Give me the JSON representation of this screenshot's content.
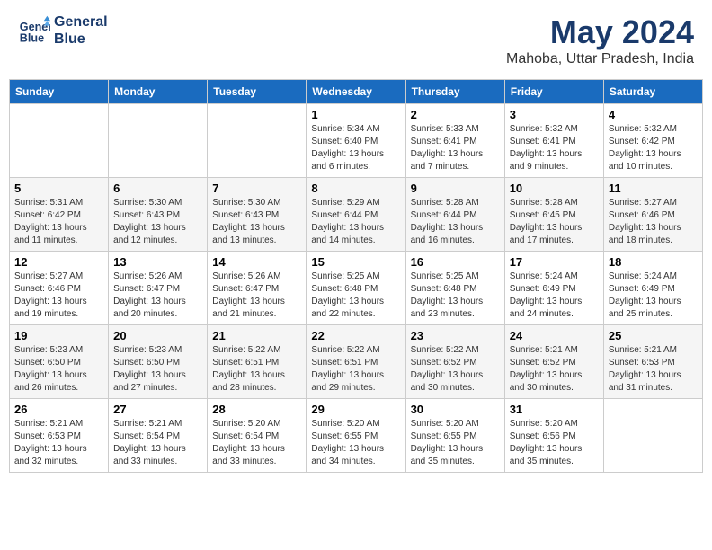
{
  "header": {
    "logo_line1": "General",
    "logo_line2": "Blue",
    "month": "May 2024",
    "location": "Mahoba, Uttar Pradesh, India"
  },
  "weekdays": [
    "Sunday",
    "Monday",
    "Tuesday",
    "Wednesday",
    "Thursday",
    "Friday",
    "Saturday"
  ],
  "weeks": [
    [
      {
        "day": "",
        "info": ""
      },
      {
        "day": "",
        "info": ""
      },
      {
        "day": "",
        "info": ""
      },
      {
        "day": "1",
        "info": "Sunrise: 5:34 AM\nSunset: 6:40 PM\nDaylight: 13 hours\nand 6 minutes."
      },
      {
        "day": "2",
        "info": "Sunrise: 5:33 AM\nSunset: 6:41 PM\nDaylight: 13 hours\nand 7 minutes."
      },
      {
        "day": "3",
        "info": "Sunrise: 5:32 AM\nSunset: 6:41 PM\nDaylight: 13 hours\nand 9 minutes."
      },
      {
        "day": "4",
        "info": "Sunrise: 5:32 AM\nSunset: 6:42 PM\nDaylight: 13 hours\nand 10 minutes."
      }
    ],
    [
      {
        "day": "5",
        "info": "Sunrise: 5:31 AM\nSunset: 6:42 PM\nDaylight: 13 hours\nand 11 minutes."
      },
      {
        "day": "6",
        "info": "Sunrise: 5:30 AM\nSunset: 6:43 PM\nDaylight: 13 hours\nand 12 minutes."
      },
      {
        "day": "7",
        "info": "Sunrise: 5:30 AM\nSunset: 6:43 PM\nDaylight: 13 hours\nand 13 minutes."
      },
      {
        "day": "8",
        "info": "Sunrise: 5:29 AM\nSunset: 6:44 PM\nDaylight: 13 hours\nand 14 minutes."
      },
      {
        "day": "9",
        "info": "Sunrise: 5:28 AM\nSunset: 6:44 PM\nDaylight: 13 hours\nand 16 minutes."
      },
      {
        "day": "10",
        "info": "Sunrise: 5:28 AM\nSunset: 6:45 PM\nDaylight: 13 hours\nand 17 minutes."
      },
      {
        "day": "11",
        "info": "Sunrise: 5:27 AM\nSunset: 6:46 PM\nDaylight: 13 hours\nand 18 minutes."
      }
    ],
    [
      {
        "day": "12",
        "info": "Sunrise: 5:27 AM\nSunset: 6:46 PM\nDaylight: 13 hours\nand 19 minutes."
      },
      {
        "day": "13",
        "info": "Sunrise: 5:26 AM\nSunset: 6:47 PM\nDaylight: 13 hours\nand 20 minutes."
      },
      {
        "day": "14",
        "info": "Sunrise: 5:26 AM\nSunset: 6:47 PM\nDaylight: 13 hours\nand 21 minutes."
      },
      {
        "day": "15",
        "info": "Sunrise: 5:25 AM\nSunset: 6:48 PM\nDaylight: 13 hours\nand 22 minutes."
      },
      {
        "day": "16",
        "info": "Sunrise: 5:25 AM\nSunset: 6:48 PM\nDaylight: 13 hours\nand 23 minutes."
      },
      {
        "day": "17",
        "info": "Sunrise: 5:24 AM\nSunset: 6:49 PM\nDaylight: 13 hours\nand 24 minutes."
      },
      {
        "day": "18",
        "info": "Sunrise: 5:24 AM\nSunset: 6:49 PM\nDaylight: 13 hours\nand 25 minutes."
      }
    ],
    [
      {
        "day": "19",
        "info": "Sunrise: 5:23 AM\nSunset: 6:50 PM\nDaylight: 13 hours\nand 26 minutes."
      },
      {
        "day": "20",
        "info": "Sunrise: 5:23 AM\nSunset: 6:50 PM\nDaylight: 13 hours\nand 27 minutes."
      },
      {
        "day": "21",
        "info": "Sunrise: 5:22 AM\nSunset: 6:51 PM\nDaylight: 13 hours\nand 28 minutes."
      },
      {
        "day": "22",
        "info": "Sunrise: 5:22 AM\nSunset: 6:51 PM\nDaylight: 13 hours\nand 29 minutes."
      },
      {
        "day": "23",
        "info": "Sunrise: 5:22 AM\nSunset: 6:52 PM\nDaylight: 13 hours\nand 30 minutes."
      },
      {
        "day": "24",
        "info": "Sunrise: 5:21 AM\nSunset: 6:52 PM\nDaylight: 13 hours\nand 30 minutes."
      },
      {
        "day": "25",
        "info": "Sunrise: 5:21 AM\nSunset: 6:53 PM\nDaylight: 13 hours\nand 31 minutes."
      }
    ],
    [
      {
        "day": "26",
        "info": "Sunrise: 5:21 AM\nSunset: 6:53 PM\nDaylight: 13 hours\nand 32 minutes."
      },
      {
        "day": "27",
        "info": "Sunrise: 5:21 AM\nSunset: 6:54 PM\nDaylight: 13 hours\nand 33 minutes."
      },
      {
        "day": "28",
        "info": "Sunrise: 5:20 AM\nSunset: 6:54 PM\nDaylight: 13 hours\nand 33 minutes."
      },
      {
        "day": "29",
        "info": "Sunrise: 5:20 AM\nSunset: 6:55 PM\nDaylight: 13 hours\nand 34 minutes."
      },
      {
        "day": "30",
        "info": "Sunrise: 5:20 AM\nSunset: 6:55 PM\nDaylight: 13 hours\nand 35 minutes."
      },
      {
        "day": "31",
        "info": "Sunrise: 5:20 AM\nSunset: 6:56 PM\nDaylight: 13 hours\nand 35 minutes."
      },
      {
        "day": "",
        "info": ""
      }
    ]
  ]
}
